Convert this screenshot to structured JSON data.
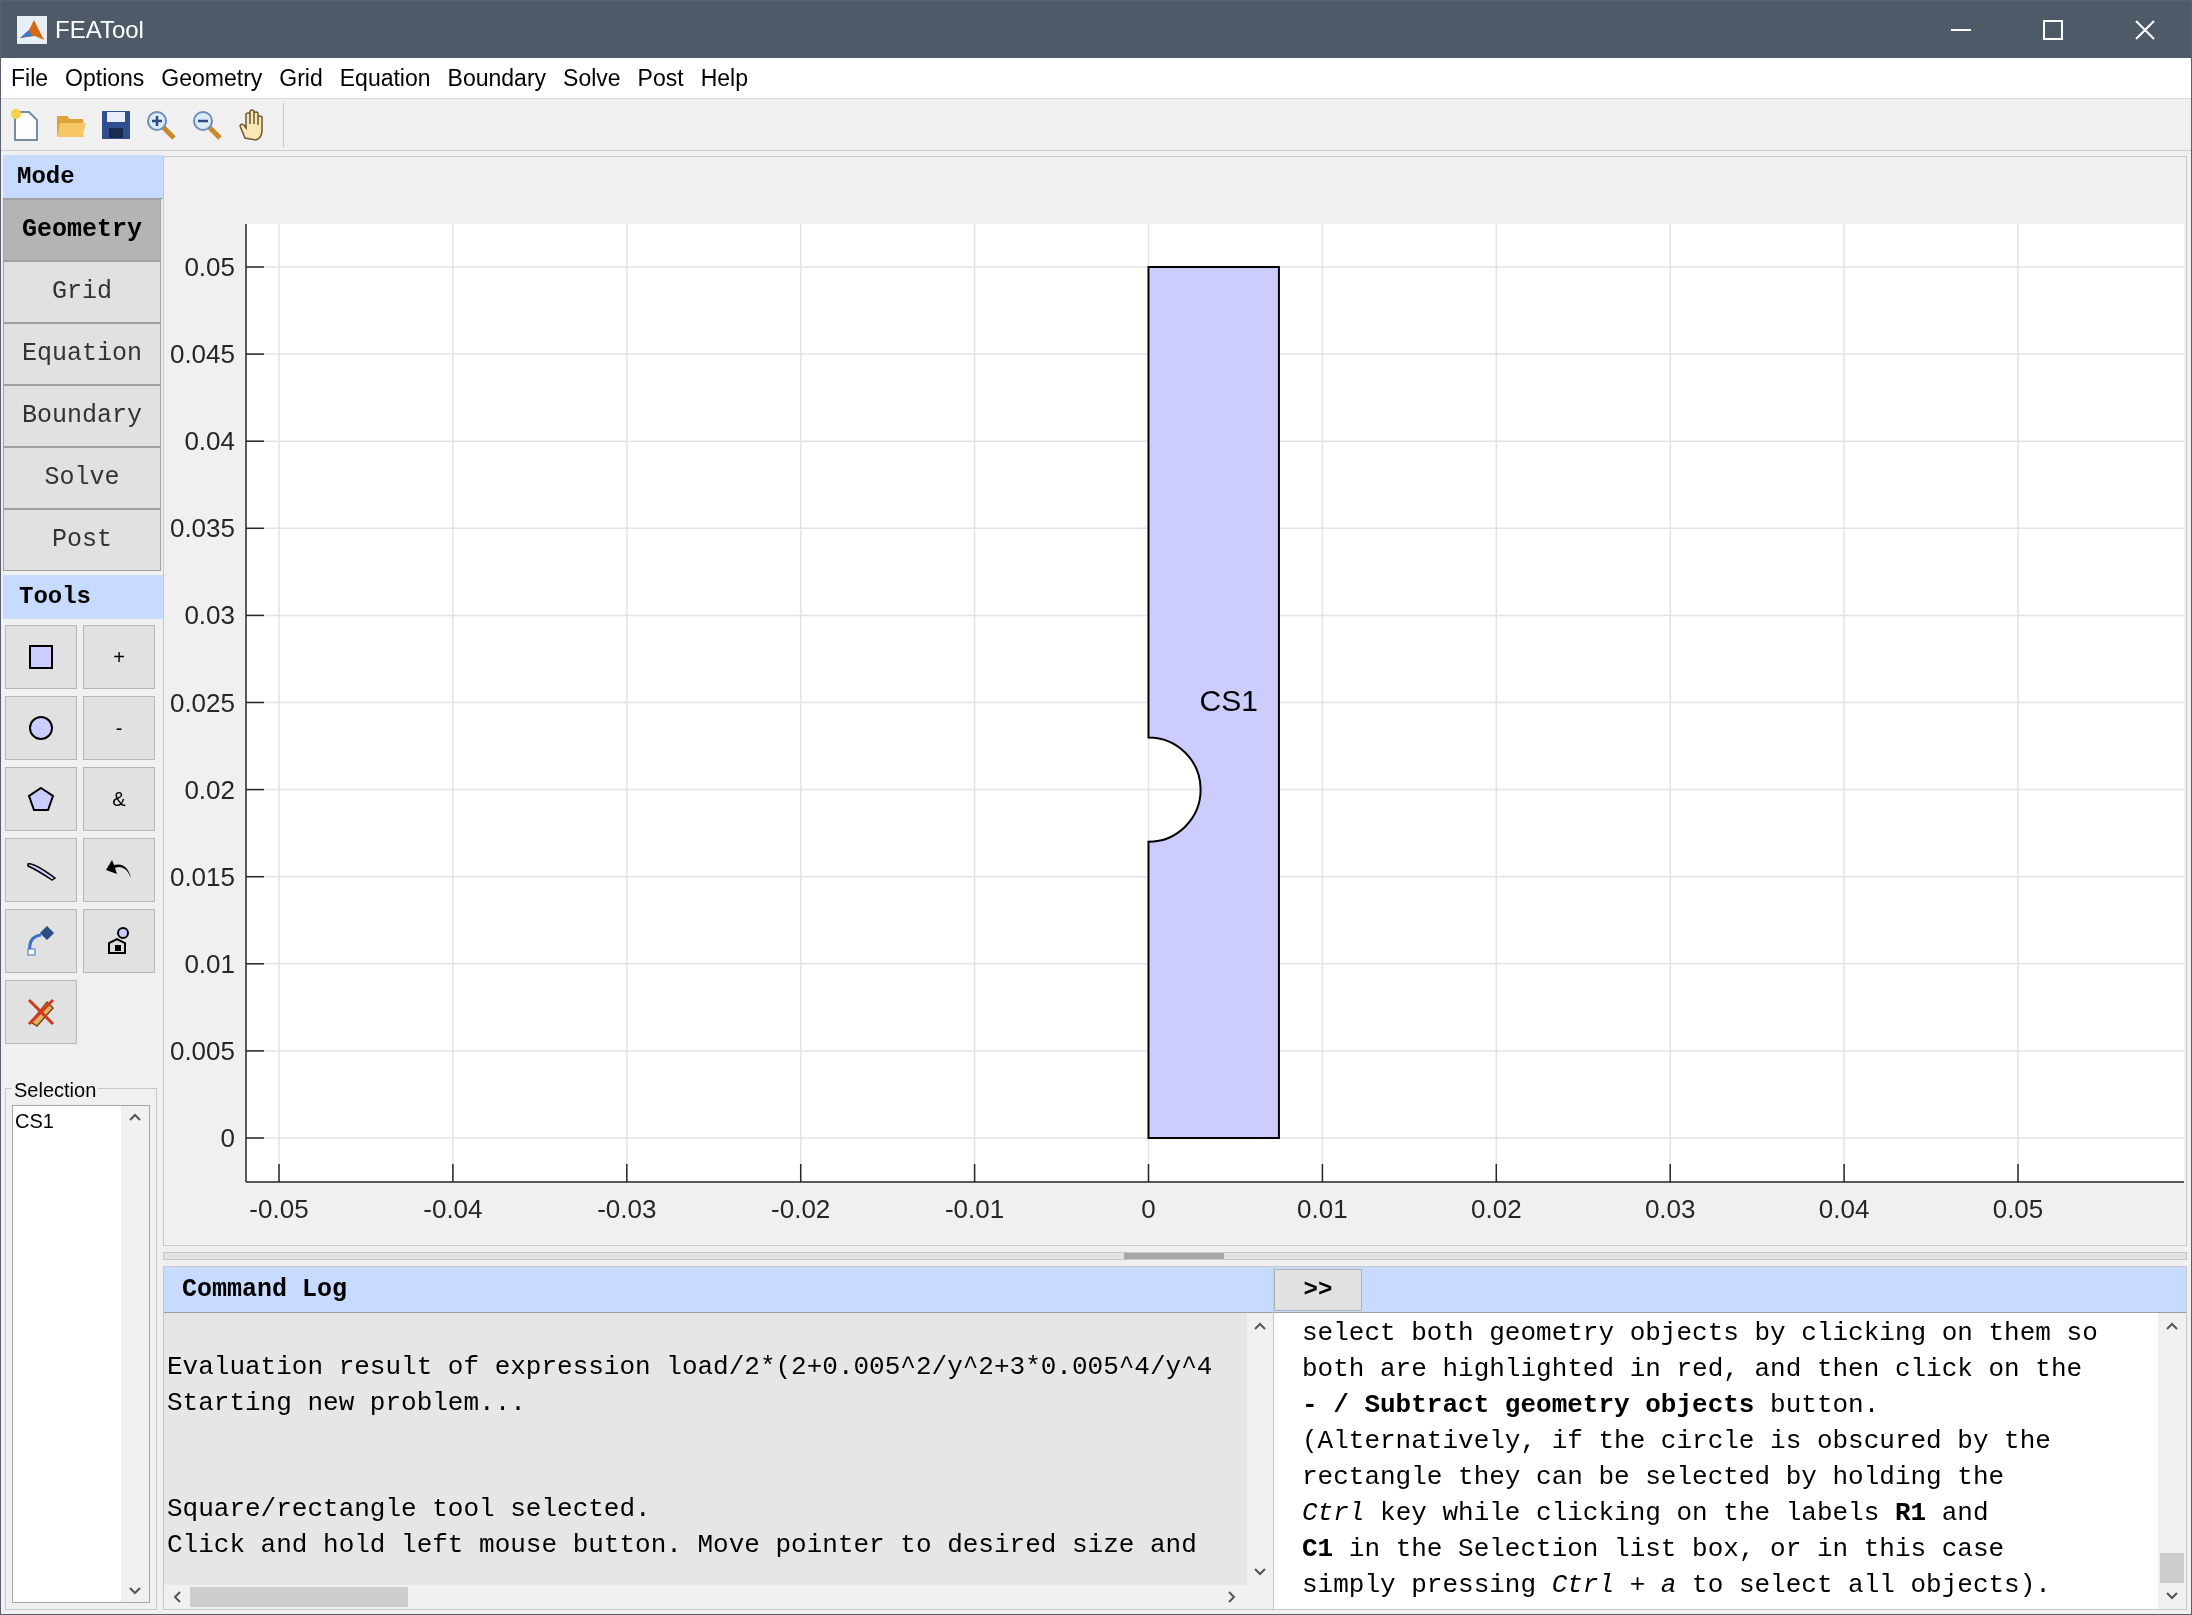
{
  "window": {
    "title": "FEATool"
  },
  "menu": [
    "File",
    "Options",
    "Geometry",
    "Grid",
    "Equation",
    "Boundary",
    "Solve",
    "Post",
    "Help"
  ],
  "mode_panel": {
    "title": "Mode",
    "modes": [
      {
        "label": "Geometry",
        "selected": true
      },
      {
        "label": "Grid",
        "selected": false
      },
      {
        "label": "Equation",
        "selected": false
      },
      {
        "label": "Boundary",
        "selected": false
      },
      {
        "label": "Solve",
        "selected": false
      },
      {
        "label": "Post",
        "selected": false
      }
    ]
  },
  "tools_panel": {
    "title": "Tools",
    "tools": [
      {
        "kind": "icon"
      },
      {
        "kind": "text",
        "label": "+"
      },
      {
        "kind": "icon"
      },
      {
        "kind": "text",
        "label": "-"
      },
      {
        "kind": "icon"
      },
      {
        "kind": "text",
        "label": "&"
      },
      {
        "kind": "icon"
      },
      {
        "kind": "icon"
      },
      {
        "kind": "icon"
      },
      {
        "kind": "icon"
      },
      {
        "kind": "icon"
      }
    ]
  },
  "selection": {
    "label": "Selection",
    "items": [
      "CS1"
    ]
  },
  "plot": {
    "x_tick_labels": [
      "-0.05",
      "-0.04",
      "-0.03",
      "-0.02",
      "-0.01",
      "0",
      "0.01",
      "0.02",
      "0.03",
      "0.04",
      "0.05"
    ],
    "y_tick_labels": [
      "0.05",
      "0.045",
      "0.04",
      "0.035",
      "0.03",
      "0.025",
      "0.02",
      "0.015",
      "0.01",
      "0.005",
      "0"
    ],
    "shape_label": "CS1"
  },
  "command_log": {
    "title": "Command Log",
    "groups": [
      [
        "Evaluation result of expression load/2*(2+0.005^2/y^2+3*0.005^4/y^4",
        "Starting new problem..."
      ],
      [
        "Square/rectangle tool selected.",
        "Click and hold left mouse button. Move pointer to desired size and"
      ]
    ]
  },
  "help_panel": {
    "toggle": ">>",
    "lines": [
      "select both geometry objects by clicking on them so",
      "both are highlighted in red, and then click on the",
      "**- / Subtract geometry objects** button.",
      "(Alternatively, if the circle is obscured by the",
      "rectangle they can be selected by holding the",
      "*Ctrl* key while clicking on the labels **R1** and",
      "**C1** in the Selection list box, or in this case",
      "simply pressing *Ctrl + a* to select all objects)."
    ]
  }
}
